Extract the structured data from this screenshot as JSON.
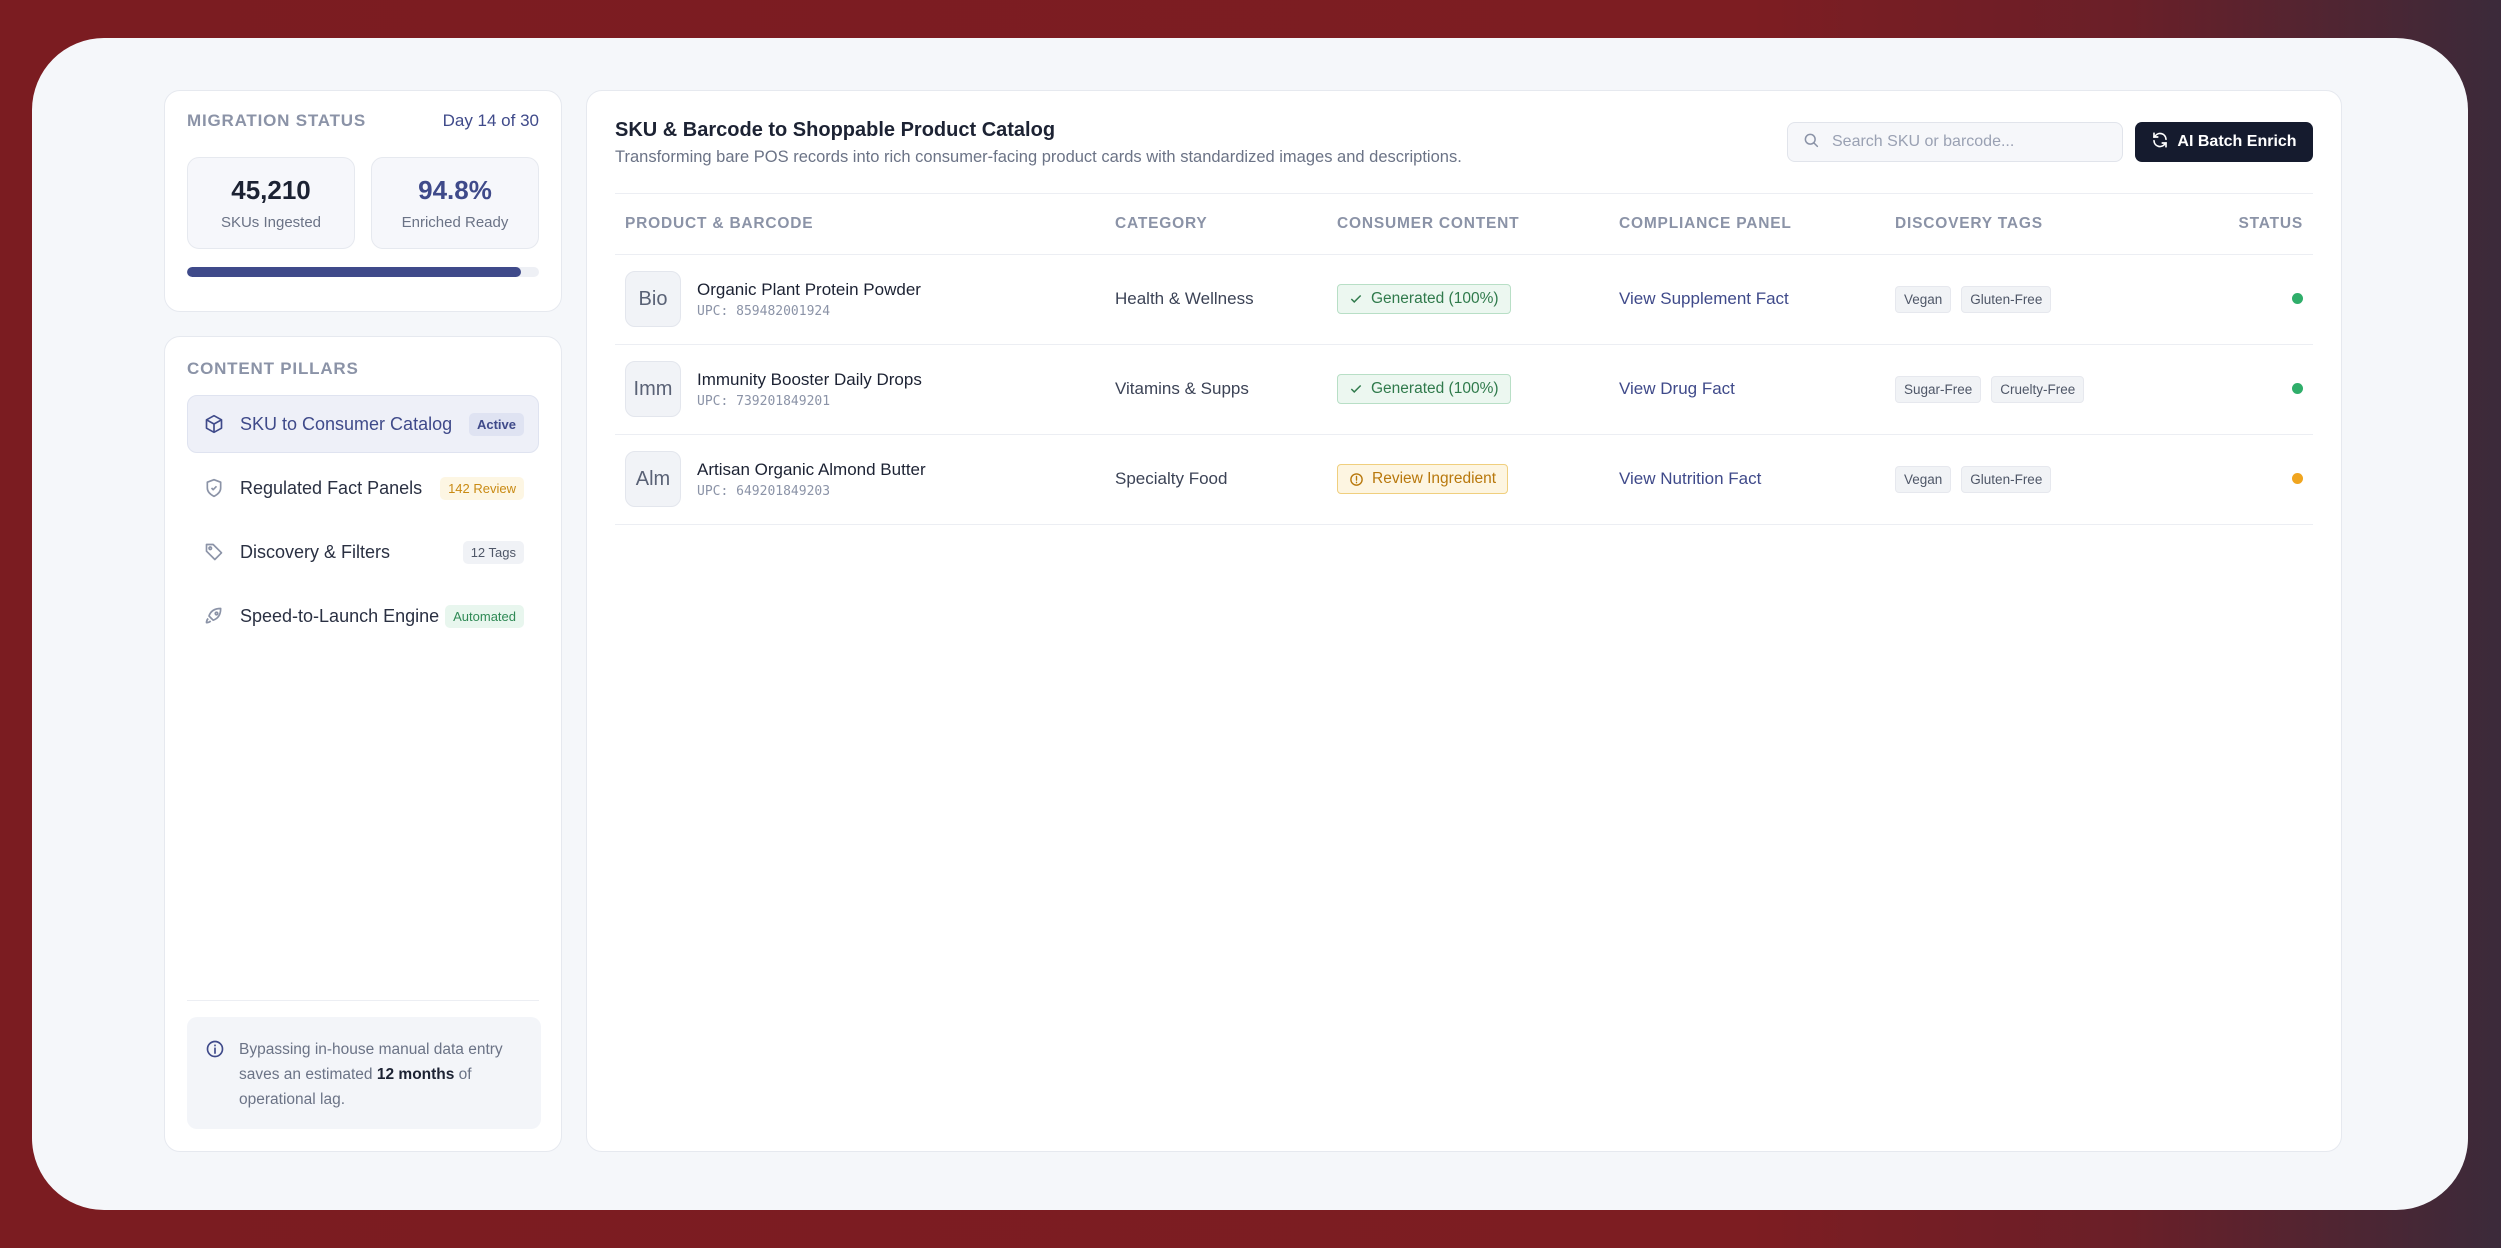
{
  "sidebar": {
    "status": {
      "title": "MIGRATION STATUS",
      "day": "Day 14 of 30",
      "skus_value": "45,210",
      "skus_label": "SKUs Ingested",
      "enriched_value": "94.8%",
      "enriched_label": "Enriched Ready",
      "progress": 0.948
    },
    "pillars_title": "CONTENT PILLARS",
    "pillars": [
      {
        "label": "SKU to Consumer Catalog",
        "badge": "Active",
        "icon": "box-icon"
      },
      {
        "label": "Regulated Fact Panels",
        "badge": "142 Review",
        "icon": "shield-icon"
      },
      {
        "label": "Discovery & Filters",
        "badge": "12 Tags",
        "icon": "tag-icon"
      },
      {
        "label": "Speed-to-Launch Engine",
        "badge": "Automated",
        "icon": "rocket-icon"
      }
    ],
    "note": {
      "before": "Bypassing in-house manual data entry saves an estimated ",
      "bold": "12 months",
      "after": " of operational lag."
    }
  },
  "main": {
    "title": "SKU & Barcode to Shoppable Product Catalog",
    "subtitle": "Transforming bare POS records into rich consumer-facing product cards with standardized images and descriptions.",
    "search_placeholder": "Search SKU or barcode...",
    "enrich_label": "AI Batch Enrich",
    "columns": [
      "PRODUCT & BARCODE",
      "CATEGORY",
      "CONSUMER CONTENT",
      "COMPLIANCE PANEL",
      "DISCOVERY TAGS",
      "STATUS"
    ],
    "rows": [
      {
        "thumb": "Bio",
        "name": "Organic Plant Protein Powder",
        "upc": "UPC: 859482001924",
        "category": "Health & Wellness",
        "content": "Generated (100%)",
        "content_state": "ok",
        "compliance": "View Supplement Fact",
        "tags": [
          "Vegan",
          "Gluten-Free"
        ],
        "status_color": "#2fae6a"
      },
      {
        "thumb": "Imm",
        "name": "Immunity Booster Daily Drops",
        "upc": "UPC: 739201849201",
        "category": "Vitamins & Supps",
        "content": "Generated (100%)",
        "content_state": "ok",
        "compliance": "View Drug Fact",
        "tags": [
          "Sugar-Free",
          "Cruelty-Free"
        ],
        "status_color": "#2fae6a"
      },
      {
        "thumb": "Alm",
        "name": "Artisan Organic Almond Butter",
        "upc": "UPC: 649201849203",
        "category": "Specialty Food",
        "content": "Review Ingredient",
        "content_state": "warn",
        "compliance": "View Nutrition Fact",
        "tags": [
          "Vegan",
          "Gluten-Free"
        ],
        "status_color": "#f0a51f"
      }
    ]
  }
}
